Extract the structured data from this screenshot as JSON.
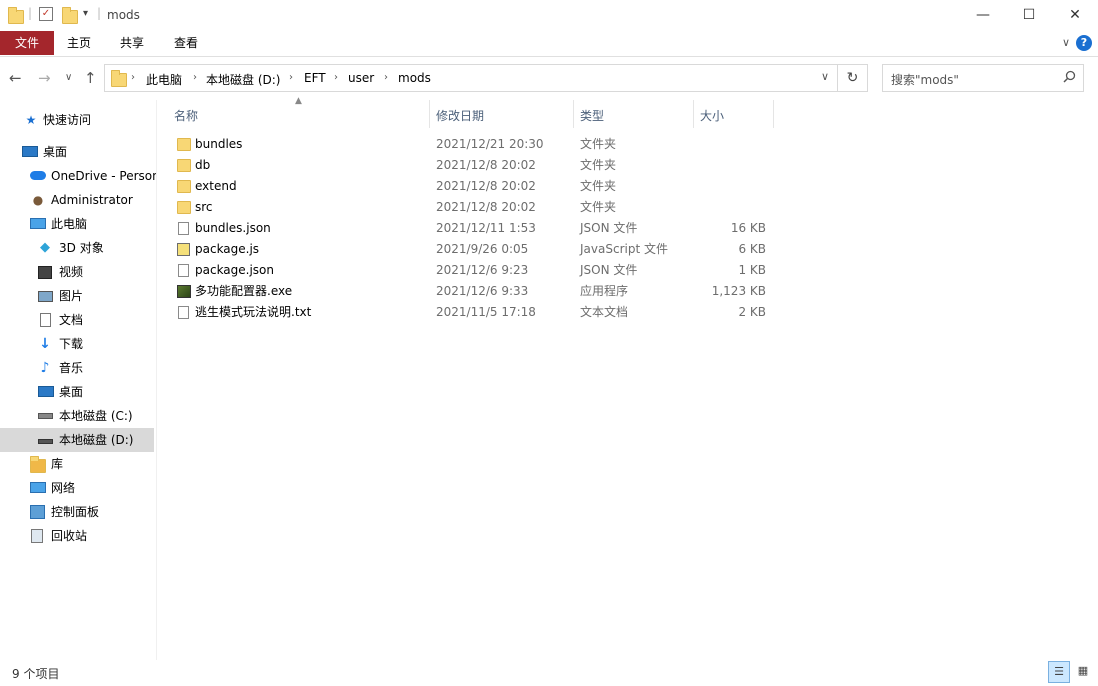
{
  "window": {
    "title": "mods",
    "controls": {
      "minimize": "—",
      "maximize": "☐",
      "close": "✕"
    }
  },
  "ribbon": {
    "tabs": [
      "文件",
      "主页",
      "共享",
      "查看"
    ],
    "help": "?",
    "toggle": "∨"
  },
  "nav": {
    "back": "←",
    "forward": "→",
    "recent": "∨",
    "up": "↑"
  },
  "address": {
    "crumbs": [
      "此电脑",
      "本地磁盘 (D:)",
      "EFT",
      "user",
      "mods"
    ],
    "separator": "›",
    "dropdown": "∨",
    "refresh": "↻"
  },
  "search": {
    "placeholder": "搜索\"mods\"",
    "icon": "search-icon"
  },
  "navpane": {
    "items": [
      {
        "label": "快速访问",
        "icon": "star-icon"
      },
      {
        "label": "桌面",
        "icon": "desktop-icon"
      },
      {
        "label": "OneDrive - Person",
        "icon": "cloud-icon"
      },
      {
        "label": "Administrator",
        "icon": "user-icon"
      },
      {
        "label": "此电脑",
        "icon": "computer-icon"
      },
      {
        "label": "3D 对象",
        "icon": "cube-icon"
      },
      {
        "label": "视频",
        "icon": "video-icon"
      },
      {
        "label": "图片",
        "icon": "picture-icon"
      },
      {
        "label": "文档",
        "icon": "document-icon"
      },
      {
        "label": "下载",
        "icon": "download-icon"
      },
      {
        "label": "音乐",
        "icon": "music-icon"
      },
      {
        "label": "桌面",
        "icon": "desktop-icon"
      },
      {
        "label": "本地磁盘 (C:)",
        "icon": "drive-icon"
      },
      {
        "label": "本地磁盘 (D:)",
        "icon": "drive-icon"
      },
      {
        "label": "库",
        "icon": "library-icon"
      },
      {
        "label": "网络",
        "icon": "network-icon"
      },
      {
        "label": "控制面板",
        "icon": "control-panel-icon"
      },
      {
        "label": "回收站",
        "icon": "recycle-bin-icon"
      }
    ]
  },
  "columns": {
    "name": "名称",
    "date": "修改日期",
    "type": "类型",
    "size": "大小"
  },
  "files": [
    {
      "name": "bundles",
      "date": "2021/12/21 20:30",
      "type": "文件夹",
      "size": "",
      "icon": "folder"
    },
    {
      "name": "db",
      "date": "2021/12/8 20:02",
      "type": "文件夹",
      "size": "",
      "icon": "folder"
    },
    {
      "name": "extend",
      "date": "2021/12/8 20:02",
      "type": "文件夹",
      "size": "",
      "icon": "folder"
    },
    {
      "name": "src",
      "date": "2021/12/8 20:02",
      "type": "文件夹",
      "size": "",
      "icon": "folder"
    },
    {
      "name": "bundles.json",
      "date": "2021/12/11 1:53",
      "type": "JSON 文件",
      "size": "16 KB",
      "icon": "doc"
    },
    {
      "name": "package.js",
      "date": "2021/9/26 0:05",
      "type": "JavaScript 文件",
      "size": "6 KB",
      "icon": "js"
    },
    {
      "name": "package.json",
      "date": "2021/12/6 9:23",
      "type": "JSON 文件",
      "size": "1 KB",
      "icon": "doc"
    },
    {
      "name": "多功能配置器.exe",
      "date": "2021/12/6 9:33",
      "type": "应用程序",
      "size": "1,123 KB",
      "icon": "exe"
    },
    {
      "name": "逃生模式玩法说明.txt",
      "date": "2021/11/5 17:18",
      "type": "文本文档",
      "size": "2 KB",
      "icon": "txt"
    }
  ],
  "status": {
    "item_count": "9 个项目"
  },
  "colors": {
    "file_tab": "#a4262c",
    "selected_nav": "#cce8ff",
    "header_text": "#4c607a"
  }
}
